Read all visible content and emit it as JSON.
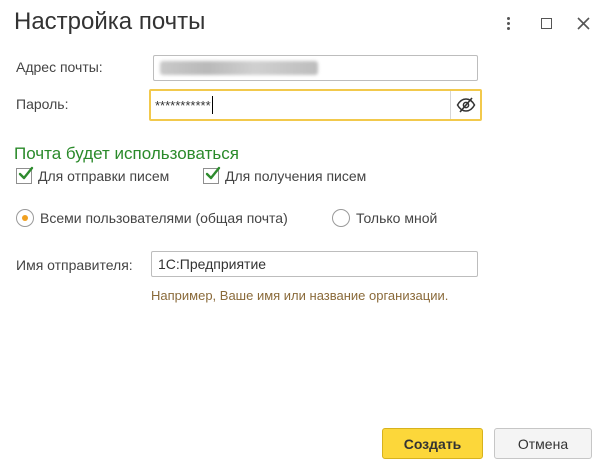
{
  "window": {
    "title": "Настройка почты"
  },
  "icons": {
    "more": "more-vertical-icon",
    "maximize": "maximize-icon",
    "close": "close-icon",
    "eye": "eye-hidden-icon",
    "check": "checkmark-icon"
  },
  "form": {
    "email_label": "Адрес почты:",
    "email_value": "",
    "password_label": "Пароль:",
    "password_value": "***********",
    "section_title": "Почта будет использоваться",
    "checkboxes": [
      {
        "label": "Для отправки писем",
        "checked": true
      },
      {
        "label": "Для получения писем",
        "checked": true
      }
    ],
    "radios": [
      {
        "label": "Всеми пользователями (общая почта)",
        "selected": true
      },
      {
        "label": "Только мной",
        "selected": false
      }
    ],
    "sender_label": "Имя отправителя:",
    "sender_value": "1С:Предприятие",
    "sender_hint": "Например, Ваше имя или название организации."
  },
  "buttons": {
    "create": "Создать",
    "cancel": "Отмена"
  },
  "colors": {
    "accent_yellow": "#fcd73a",
    "focus_border": "#f2c94c",
    "section_green": "#2a8a2a",
    "check_green": "#2e8b2e",
    "radio_orange": "#f0a020",
    "hint_brown": "#8a6a3a"
  }
}
